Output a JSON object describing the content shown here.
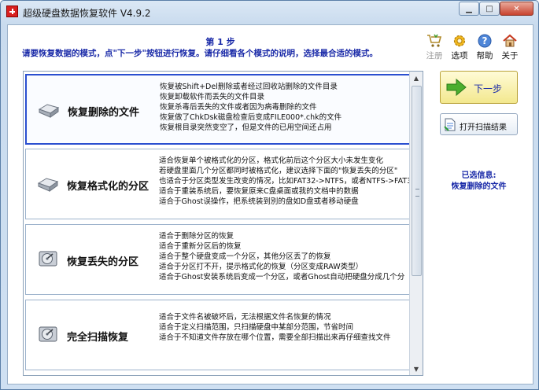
{
  "window": {
    "title": "超级硬盘数据恢复软件 V4.9.2",
    "minimize_label": "▁",
    "maximize_label": "□",
    "close_label": "✕"
  },
  "header": {
    "step_title": "第 1 步",
    "instruction": "请要恢复数据的模式，点\"下一步\"按钮进行恢复。请仔细看各个模式的说明，选择最合适的模式。"
  },
  "toolbar": {
    "items": [
      {
        "label": "注册",
        "icon": "cart-icon",
        "enabled": false
      },
      {
        "label": "选项",
        "icon": "gear-icon",
        "enabled": true
      },
      {
        "label": "帮助",
        "icon": "help-icon",
        "enabled": true
      },
      {
        "label": "关于",
        "icon": "home-icon",
        "enabled": true
      }
    ]
  },
  "modes": [
    {
      "name": "恢复删除的文件",
      "selected": true,
      "lines": [
        "恢复被Shift+Del删除或者经过回收站删除的文件目录",
        "恢复卸载软件而丢失的文件目录",
        "恢复杀毒后丢失的文件或者因为病毒删除的文件",
        "恢复做了ChkDsk磁盘检查后变成FILE000*.chk的文件",
        "恢复根目录突然变空了，但是文件的已用空间还占用"
      ]
    },
    {
      "name": "恢复格式化的分区",
      "selected": false,
      "lines": [
        "适合恢复单个被格式化的分区，格式化前后这个分区大小未发生变化",
        "若硬盘里面几个分区都同时被格式化，建议选择下面的\"恢复丢失的分区\"",
        "也适合于分区类型发生改变的情况，比如FAT32->NTFS，或者NTFS->FAT3",
        "适合于重装系统后，要恢复原来C盘桌面或我的文档中的数据",
        "适合于Ghost误操作，把系统装到別的盘如D盘或者移动硬盘"
      ]
    },
    {
      "name": "恢复丢失的分区",
      "selected": false,
      "lines": [
        "适合于删除分区的恢复",
        "适合于重新分区后的恢复",
        "适合于整个硬盘变成一个分区，其他分区丢了的恢复",
        "适合于分区打不开，提示格式化的恢复（分区变成RAW类型）",
        "适合于Ghost安装系统后变成一个分区，或者Ghost自动把硬盘分成几个分"
      ]
    },
    {
      "name": "完全扫描恢复",
      "selected": false,
      "lines": [
        "适合于文件名被破坏后，无法根据文件名恢复的情况",
        "适合于定义扫描范围，只扫描硬盘中某部分范围，节省时间",
        "适合于不知道文件存放在哪个位置，需要全部扫描出来再仔细查找文件"
      ]
    }
  ],
  "scrollbar": {
    "up": "▲",
    "down": "▼"
  },
  "actions": {
    "next_label": "下一步",
    "open_scan_label": "打开扫描结果"
  },
  "selection_info": {
    "heading": "已选信息:",
    "value": "恢复删除的文件"
  },
  "colors": {
    "accent": "#1a2aa8",
    "selected_border": "#2a4fd0"
  }
}
